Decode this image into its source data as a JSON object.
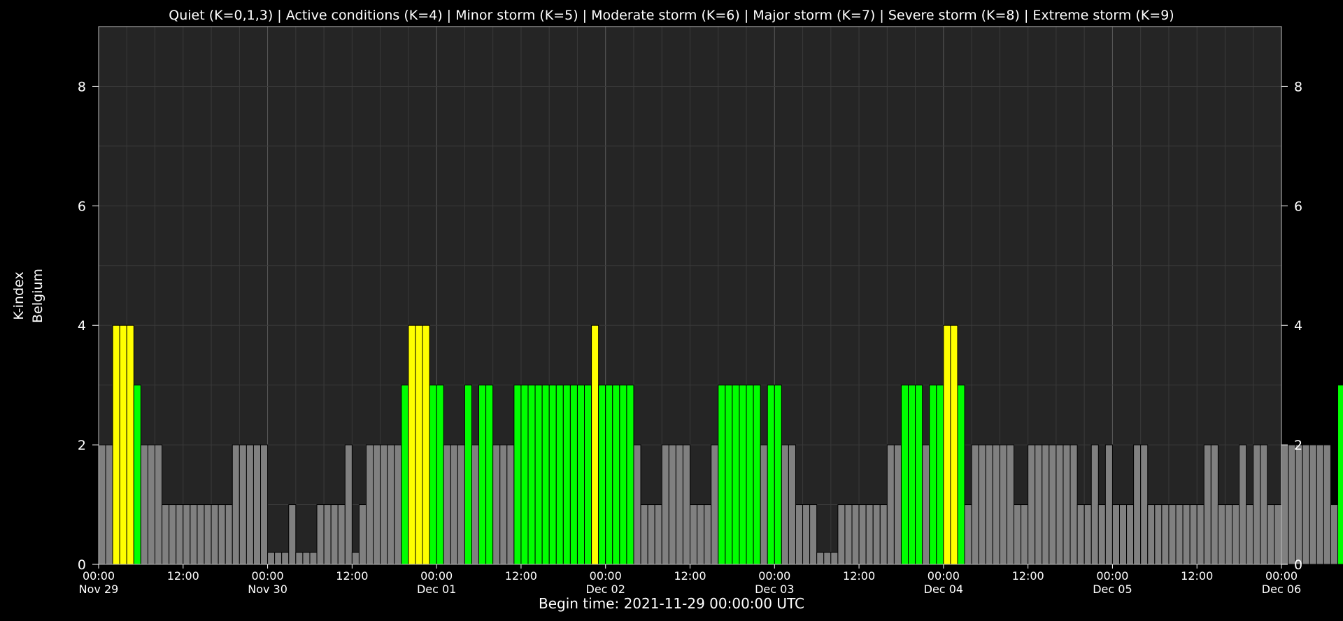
{
  "chart_data": {
    "type": "bar",
    "title": "Quiet (K=0,1,3) | Active conditions (K=4) | Minor storm (K=5) | Moderate storm (K=6) | Major storm (K=7) | Severe storm (K=8) | Extreme storm (K=9)",
    "ylabel_line1": "K-index",
    "ylabel_line2": "Belgium",
    "xlabel": "Begin time: 2021-11-29 00:00:00 UTC",
    "ylim": [
      0,
      9
    ],
    "y_ticks": [
      0,
      2,
      4,
      6,
      8
    ],
    "y_tick_labels": [
      "0",
      "2",
      "4",
      "6",
      "8"
    ],
    "x_range_hours": [
      0,
      168
    ],
    "x_ticks": [
      {
        "hour": 0,
        "time": "00:00",
        "date": "Nov 29"
      },
      {
        "hour": 12,
        "time": "12:00",
        "date": ""
      },
      {
        "hour": 24,
        "time": "00:00",
        "date": "Nov 30"
      },
      {
        "hour": 36,
        "time": "12:00",
        "date": ""
      },
      {
        "hour": 48,
        "time": "00:00",
        "date": "Dec 01"
      },
      {
        "hour": 60,
        "time": "12:00",
        "date": ""
      },
      {
        "hour": 72,
        "time": "00:00",
        "date": "Dec 02"
      },
      {
        "hour": 84,
        "time": "12:00",
        "date": ""
      },
      {
        "hour": 96,
        "time": "00:00",
        "date": "Dec 03"
      },
      {
        "hour": 108,
        "time": "12:00",
        "date": ""
      },
      {
        "hour": 120,
        "time": "00:00",
        "date": "Dec 04"
      },
      {
        "hour": 132,
        "time": "12:00",
        "date": ""
      },
      {
        "hour": 144,
        "time": "00:00",
        "date": "Dec 05"
      },
      {
        "hour": 156,
        "time": "12:00",
        "date": ""
      },
      {
        "hour": 168,
        "time": "00:00",
        "date": "Dec 06"
      }
    ],
    "bar_interval_hours": 1,
    "values": [
      2,
      2,
      4,
      4,
      4,
      3,
      2,
      2,
      2,
      1,
      1,
      1,
      1,
      1,
      1,
      1,
      1,
      1,
      1,
      2,
      2,
      2,
      2,
      2,
      0.2,
      0.2,
      0.2,
      1,
      0.2,
      0.2,
      0.2,
      1,
      1,
      1,
      1,
      2,
      0.2,
      1,
      2,
      2,
      2,
      2,
      2,
      3,
      4,
      4,
      4,
      3,
      3,
      2,
      2,
      2,
      3,
      2,
      3,
      3,
      2,
      2,
      2,
      3,
      3,
      3,
      3,
      3,
      3,
      3,
      3,
      3,
      3,
      3,
      4,
      3,
      3,
      3,
      3,
      3,
      2,
      1,
      1,
      1,
      2,
      2,
      2,
      2,
      1,
      1,
      1,
      2,
      3,
      3,
      3,
      3,
      3,
      3,
      2,
      3,
      3,
      2,
      2,
      1,
      1,
      1,
      0.2,
      0.2,
      0.2,
      1,
      1,
      1,
      1,
      1,
      1,
      1,
      2,
      2,
      3,
      3,
      3,
      2,
      3,
      3,
      4,
      4,
      3,
      1,
      2,
      2,
      2,
      2,
      2,
      2,
      1,
      1,
      2,
      2,
      2,
      2,
      2,
      2,
      2,
      1,
      1,
      2,
      1,
      2,
      1,
      1,
      1,
      2,
      2,
      1,
      1,
      1,
      1,
      1,
      1,
      1,
      1,
      2,
      2,
      1,
      1,
      1,
      2,
      1,
      2,
      2,
      1,
      1,
      2,
      2,
      2,
      2,
      2,
      2,
      2,
      1,
      3
    ],
    "colors": {
      "quiet": "#808080",
      "k3": "#00ff00",
      "active": "#ffff00",
      "background": "#000000",
      "plot_area": "#252525",
      "grid": "#3a3a3a",
      "day_line": "#5a5a5a"
    },
    "grid": true
  }
}
